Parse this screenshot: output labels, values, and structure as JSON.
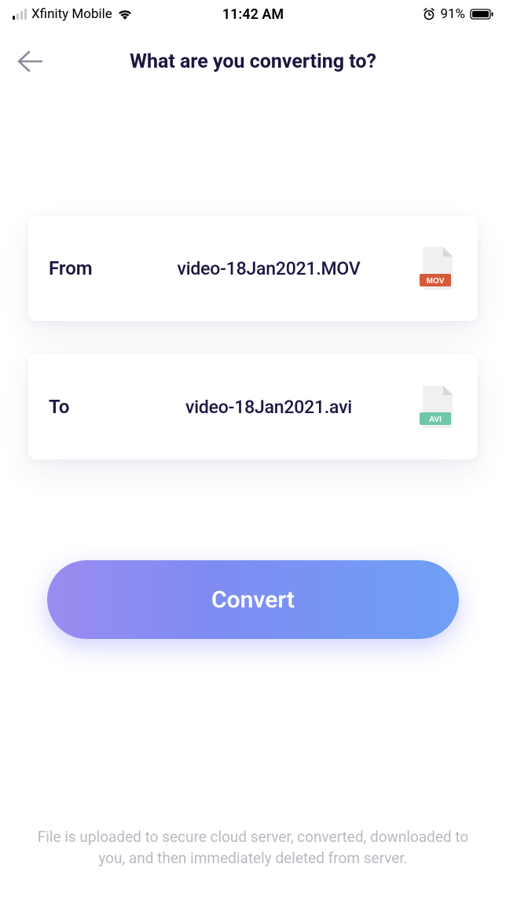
{
  "status_bar": {
    "carrier": "Xfinity Mobile",
    "time": "11:42 AM",
    "battery_pct": "91%"
  },
  "header": {
    "title": "What are you converting to?"
  },
  "cards": {
    "from": {
      "label": "From",
      "filename": "video-18Jan2021.MOV",
      "badge": "MOV",
      "badge_color": "#d65a3c"
    },
    "to": {
      "label": "To",
      "filename": "video-18Jan2021.avi",
      "badge": "AVI",
      "badge_color": "#6fc7a9"
    }
  },
  "convert_button": {
    "label": "Convert"
  },
  "footer": {
    "note": "File is uploaded to secure cloud server, converted, downloaded to you, and then immediately deleted from server."
  }
}
